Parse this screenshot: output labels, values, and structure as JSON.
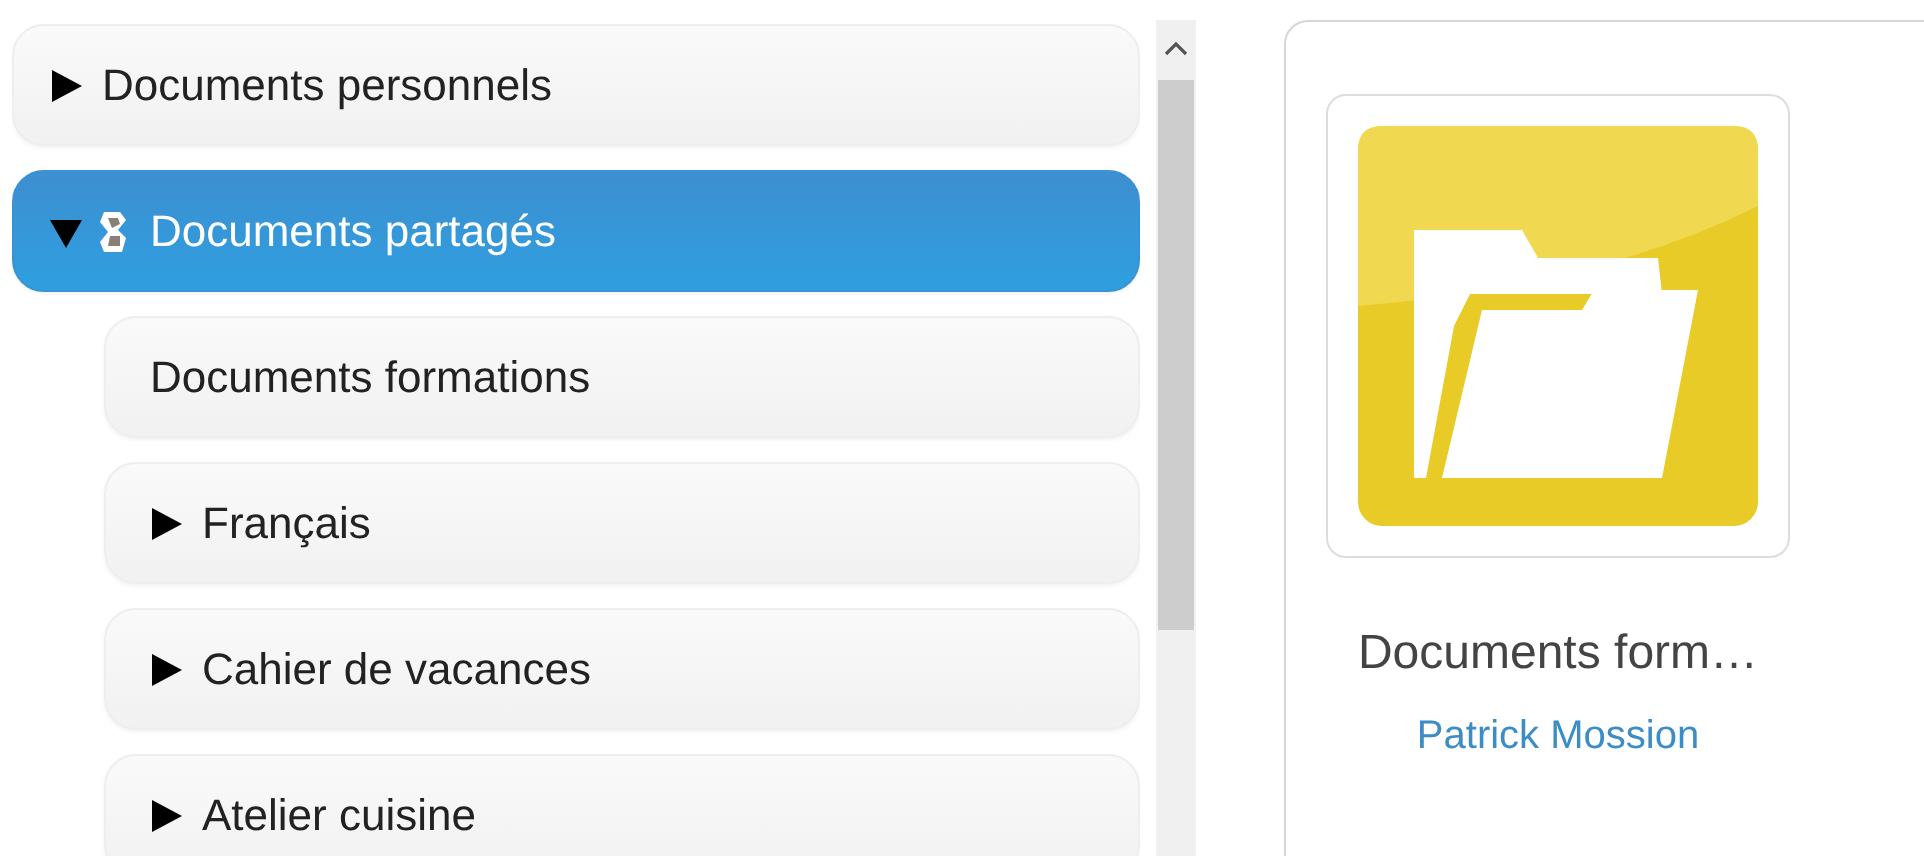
{
  "tree": {
    "items": [
      {
        "label": "Documents personnels",
        "kind": "folder",
        "expanded": false,
        "selected": false
      },
      {
        "label": "Documents partagés",
        "kind": "shared-folder",
        "expanded": true,
        "selected": true,
        "children": [
          {
            "label": "Documents formations",
            "kind": "leaf",
            "selected": false
          },
          {
            "label": "Français",
            "kind": "folder",
            "expanded": false,
            "selected": false
          },
          {
            "label": "Cahier de vacances",
            "kind": "folder",
            "expanded": false,
            "selected": false
          },
          {
            "label": "Atelier cuisine",
            "kind": "folder",
            "expanded": false,
            "selected": false
          }
        ]
      }
    ]
  },
  "card": {
    "title": "Documents form…",
    "author": "Patrick Mossion"
  }
}
